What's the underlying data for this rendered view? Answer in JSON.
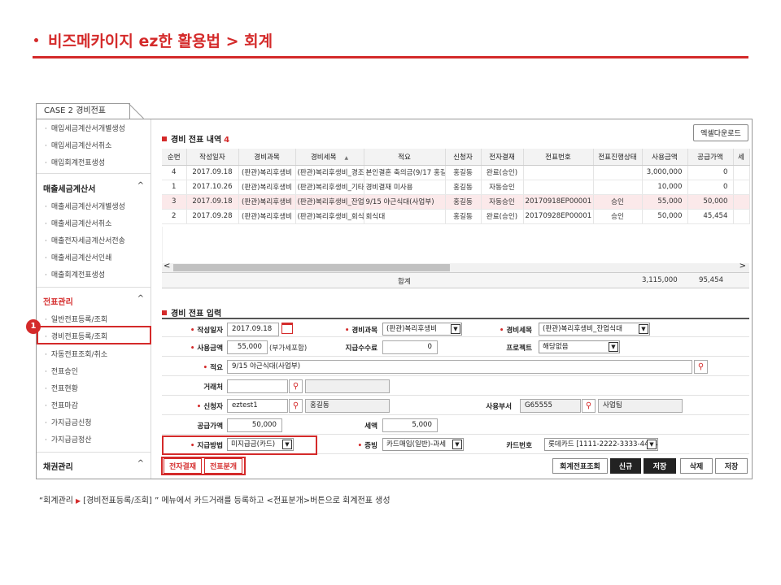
{
  "slide": {
    "bullet": "·",
    "title": "비즈메카이지 ez한 활용법 > 회계"
  },
  "case_tab": "CASE 2 경비전표",
  "sidebar": {
    "group1_items": [
      "매입세금계산서개별생성",
      "매입세금계산서취소",
      "매입회계전표생성"
    ],
    "group2": {
      "title": "매출세금계산서",
      "items": [
        "매출세금계산서개별생성",
        "매출세금계산서취소",
        "매출전자세금계산서전송",
        "매출세금계산서인쇄",
        "매출회계전표생성"
      ]
    },
    "group3": {
      "title": "전표관리",
      "items": [
        "일반전표등록/조회",
        "경비전표등록/조회",
        "자동전표조회/취소",
        "전표승인",
        "전표현황",
        "전표마감",
        "가지급금신청",
        "가지급금정산"
      ]
    },
    "group4": {
      "title": "채권관리"
    },
    "caret": "^",
    "badge": "1"
  },
  "list_section": {
    "title": "경비 전표 내역",
    "count": "4",
    "excel_button": "엑셀다운로드",
    "columns": [
      "순번",
      "작성일자",
      "경비과목",
      "경비세목",
      "적요",
      "신청자",
      "전자결재",
      "전표번호",
      "전표진행상태",
      "사용금액",
      "공급가액",
      "세"
    ],
    "rows": [
      [
        "4",
        "2017.09.18",
        "(판관)복리후생비",
        "(판관)복리후생비_경조",
        "본인결혼 축의금(9/17 홍길동",
        "홍길동",
        "완료(승인)",
        "",
        "",
        "3,000,000",
        "0"
      ],
      [
        "1",
        "2017.10.26",
        "(판관)복리후생비",
        "(판관)복리후생비_기타",
        "경비결재 미사용",
        "홍길동",
        "자동승인",
        "",
        "",
        "10,000",
        "0"
      ],
      [
        "3",
        "2017.09.18",
        "(판관)복리후생비",
        "(판관)복리후생비_잔업",
        "9/15 야근식대(사업부)",
        "홍길동",
        "자동승인",
        "20170918EP00001",
        "승인",
        "55,000",
        "50,000"
      ],
      [
        "2",
        "2017.09.28",
        "(판관)복리후생비",
        "(판관)복리후생비_회식",
        "회식대",
        "홍길동",
        "완료(승인)",
        "20170928EP00001",
        "승인",
        "50,000",
        "45,454"
      ]
    ],
    "scroll_left": "<",
    "scroll_right": ">",
    "sum_label": "합계",
    "sum_amount": "3,115,000",
    "sum_supply": "95,454"
  },
  "form_section": {
    "title": "경비 전표 입력",
    "date_label": "작성일자",
    "date_value": "2017.09.18",
    "expense_label": "경비과목",
    "expense_value": "(판관)복리후생비",
    "detail_label": "경비세목",
    "detail_value": "(판관)복리후생비_잔업식대",
    "amount_label": "사용금액",
    "amount_value": "55,000",
    "amount_note": "(부가세포함)",
    "fee_label": "지급수수료",
    "fee_value": "0",
    "project_label": "프로젝트",
    "project_value": "해당없음",
    "memo_label": "적요",
    "memo_value": "9/15 야근식대(사업부)",
    "vendor_label": "거래처",
    "applicant_label": "신청자",
    "applicant_id": "eztest1",
    "applicant_name": "홍길동",
    "dept_label": "사용부서",
    "dept_code": "G65555",
    "dept_name": "사업팀",
    "supply_label": "공급가액",
    "supply_value": "50,000",
    "tax_label": "세액",
    "tax_value": "5,000",
    "pay_label": "지급방법",
    "pay_value": "미지급금(카드)",
    "proof_label": "증빙",
    "proof_value": "카드매입(일반)-과세",
    "card_label": "카드번호",
    "card_value": "롯데카드 [1111-2222-3333-4444"
  },
  "buttons": {
    "e_approval": "전자결재",
    "split": "전표분개",
    "acc_lookup": "회계전표조회",
    "new": "신규",
    "save": "저장",
    "delete": "삭제",
    "save2": "저장"
  },
  "caption": {
    "menu": "“회계관리",
    "arrow": "▶",
    "path": "[경비전표등록/조회] ”",
    "desc": "메뉴에서 카드거래를 등록하고 <전표분개>버튼으로 회계전표 생성"
  },
  "colors": {
    "accent": "#d42a2a",
    "highlight_row": "#fbe9ea"
  }
}
